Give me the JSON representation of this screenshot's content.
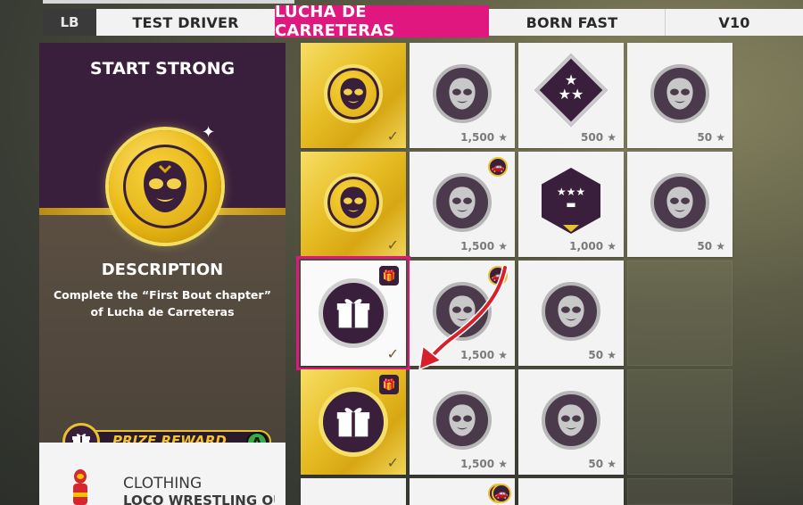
{
  "tabs": {
    "lb_label": "LB",
    "items": [
      {
        "label": "TEST DRIVER",
        "active": false
      },
      {
        "label": "LUCHA DE CARRETERAS",
        "active": true
      },
      {
        "label": "BORN FAST",
        "active": false
      },
      {
        "label": "V10",
        "active": false
      }
    ]
  },
  "detail": {
    "title": "START STRONG",
    "description_heading": "DESCRIPTION",
    "description_text": "Complete the “First Bout chapter” of Lucha de Carreteras",
    "prize_label": "PRIZE REWARD",
    "prize_button": "A",
    "reward_type": "CLOTHING",
    "reward_name": "LOCO WRESTLING OUTFIT"
  },
  "grid": {
    "rows": [
      [
        {
          "style": "gold",
          "icon": "mask-gold-icon",
          "points": "",
          "check": true
        },
        {
          "style": "white",
          "icon": "mask-icon",
          "points": "1,500",
          "check": false
        },
        {
          "style": "white",
          "icon": "stars-diamond-icon",
          "points": "500",
          "check": false
        },
        {
          "style": "white",
          "icon": "mask-icon",
          "points": "50",
          "check": false
        }
      ],
      [
        {
          "style": "gold",
          "icon": "mask-gold-icon",
          "points": "",
          "check": true
        },
        {
          "style": "white",
          "icon": "mask-icon",
          "points": "1,500",
          "check": false,
          "car_badge": true
        },
        {
          "style": "white",
          "icon": "car-stars-hex-icon",
          "points": "1,000",
          "check": false
        },
        {
          "style": "white",
          "icon": "mask-icon",
          "points": "50",
          "check": false
        }
      ],
      [
        {
          "style": "selected",
          "icon": "gift-icon",
          "points": "",
          "check": true,
          "gift_badge": true
        },
        {
          "style": "white",
          "icon": "mask-icon",
          "points": "1,500",
          "check": false,
          "car_badge": true
        },
        {
          "style": "white",
          "icon": "mask-icon",
          "points": "50",
          "check": false
        }
      ],
      [
        {
          "style": "gold",
          "icon": "gift-icon",
          "points": "",
          "check": true,
          "gift_badge": true
        },
        {
          "style": "white",
          "icon": "mask-icon",
          "points": "1,500",
          "check": false
        },
        {
          "style": "white",
          "icon": "mask-icon",
          "points": "50",
          "check": false
        }
      ]
    ]
  },
  "colors": {
    "accent_pink": "#e0177f",
    "gold": "#e6bc24",
    "purple": "#3a1f3c",
    "arrow_red": "#d8202a"
  }
}
